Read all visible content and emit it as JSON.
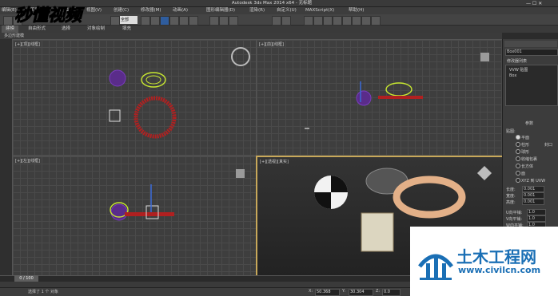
{
  "window": {
    "title": "Autodesk 3ds Max  2014 x64  -  无标题"
  },
  "menu": {
    "items": [
      "编辑(E)",
      "工具(T)",
      "组(G)",
      "视图(V)",
      "创建(C)",
      "修改器(M)",
      "动画(A)",
      "图形编辑器(D)",
      "渲染(R)",
      "自定义(U)",
      "MAXScript(X)",
      "帮助(H)"
    ]
  },
  "toolbar": {
    "selection_filter": "全部"
  },
  "ribbon": {
    "tabs": [
      "建模",
      "自由形式",
      "选择",
      "对象绘制",
      "填充"
    ]
  },
  "subribbon": {
    "label": "多边形建模"
  },
  "viewports": {
    "top": "[+][顶][线框]",
    "front": "[+][前][线框]",
    "left": "[+][左][线框]",
    "perspective": "[+][透视][真实]"
  },
  "command_panel": {
    "object_name": "Box001",
    "modifier_list": "修改器列表",
    "stack": [
      "VVW 贴图",
      "Box"
    ],
    "section": "参数",
    "mapping_label": "贴图:",
    "mapping_options": [
      "平面",
      "柱形",
      "球形",
      "收缩包裹",
      "长方体",
      "面",
      "XYZ 到 UVW"
    ],
    "cap_label": "封口",
    "params": [
      {
        "label": "长度:",
        "value": "0.001"
      },
      {
        "label": "宽度:",
        "value": "0.001"
      },
      {
        "label": "高度:",
        "value": "0.001"
      },
      {
        "label": "U向平铺:",
        "value": "1.0"
      },
      {
        "label": "V向平铺:",
        "value": "1.0"
      },
      {
        "label": "W向平铺:",
        "value": "1.0"
      }
    ]
  },
  "timeline": {
    "frame": "0 / 100"
  },
  "status": {
    "selection": "选择了 1 个 对象",
    "x_label": "X:",
    "x": "50.368",
    "y_label": "Y:",
    "y": "30.304",
    "z_label": "Z:",
    "z": "0.0"
  },
  "watermark_top": {
    "text": "秒懂视频"
  },
  "watermark_bottom": {
    "title": "土木工程网",
    "url": "www.civilcn.com"
  },
  "colors": {
    "accent": "#c8a85a",
    "watermark_blue": "#1a6fb5"
  }
}
